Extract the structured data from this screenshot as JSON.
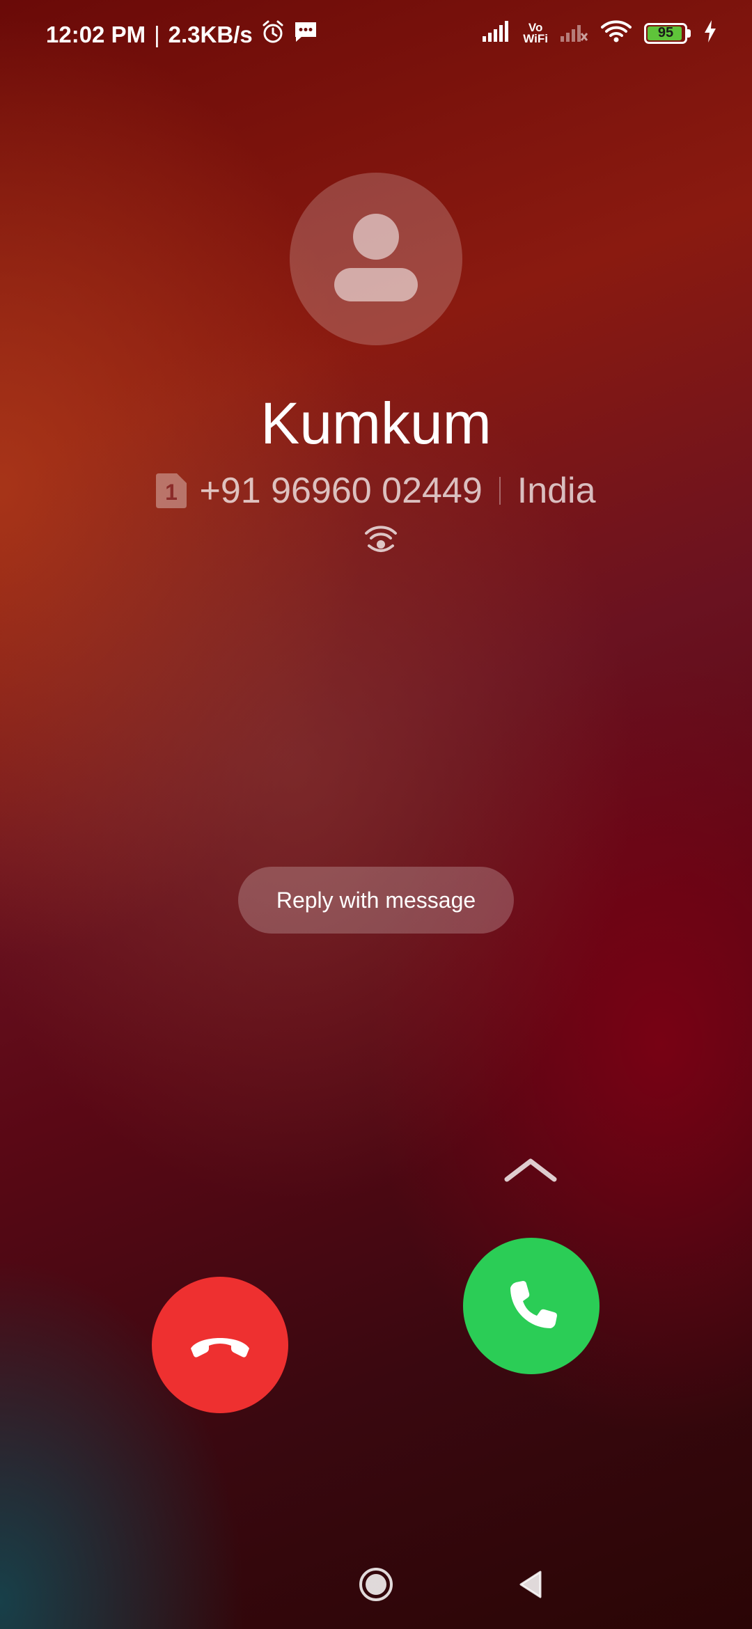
{
  "status_bar": {
    "time": "12:02 PM",
    "separator": "|",
    "net_speed": "2.3KB/s",
    "vowifi_top": "Vo",
    "vowifi_bottom": "WiFi",
    "battery_level": "95",
    "icons": [
      "alarm-icon",
      "message-icon",
      "signal-icon",
      "vowifi-icon",
      "signal-no-service-icon",
      "wifi-icon",
      "battery-icon",
      "charging-icon"
    ]
  },
  "caller": {
    "name": "Kumkum",
    "number": "+91 96960 02449",
    "location": "India",
    "sim_slot": "1",
    "avatar_icon": "person-icon",
    "wifi_call_icon": "wifi-calling-icon"
  },
  "actions": {
    "reply_label": "Reply with message",
    "decline_icon": "end-call-icon",
    "answer_icon": "phone-icon",
    "swipe_icon": "chevron-up-icon"
  },
  "colors": {
    "decline": "#ee3030",
    "answer": "#2bcd56",
    "battery": "#5fc43a"
  },
  "nav_bar": {
    "icons": [
      "home-icon",
      "back-icon"
    ]
  }
}
